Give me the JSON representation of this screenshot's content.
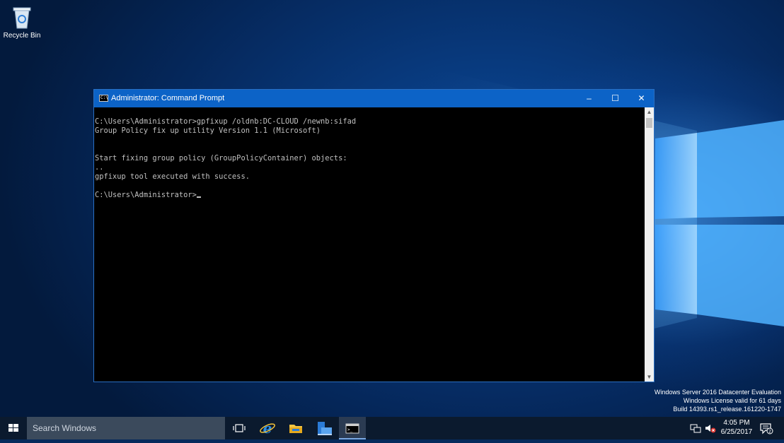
{
  "desktop": {
    "icons": [
      {
        "label": "Recycle Bin",
        "icon": "recycle-bin-icon"
      }
    ],
    "watermark": [
      "Windows Server 2016 Datacenter Evaluation",
      "Windows License valid for 61 days",
      "Build 14393.rs1_release.161220-1747"
    ]
  },
  "window": {
    "title": "Administrator: Command Prompt",
    "controls": {
      "minimize": "–",
      "maximize": "☐",
      "close": "✕"
    },
    "console_lines": [
      "C:\\Users\\Administrator>gpfixup /oldnb:DC-CLOUD /newnb:sifad",
      "Group Policy fix up utility Version 1.1 (Microsoft)",
      "",
      "",
      "Start fixing group policy (GroupPolicyContainer) objects:",
      "..",
      "gpfixup tool executed with success.",
      ""
    ],
    "prompt": "C:\\Users\\Administrator>"
  },
  "taskbar": {
    "search_placeholder": "Search Windows",
    "apps": [
      {
        "name": "task-view-icon"
      },
      {
        "name": "internet-explorer-icon"
      },
      {
        "name": "file-explorer-icon"
      },
      {
        "name": "server-manager-icon"
      },
      {
        "name": "command-prompt-icon",
        "active": true
      }
    ],
    "clock": {
      "time": "4:05 PM",
      "date": "6/25/2017"
    }
  },
  "colors": {
    "accent": "#0c63c7",
    "console_bg": "#000000",
    "console_fg": "#c0c0c0",
    "taskbar": "#0b1a2e"
  }
}
